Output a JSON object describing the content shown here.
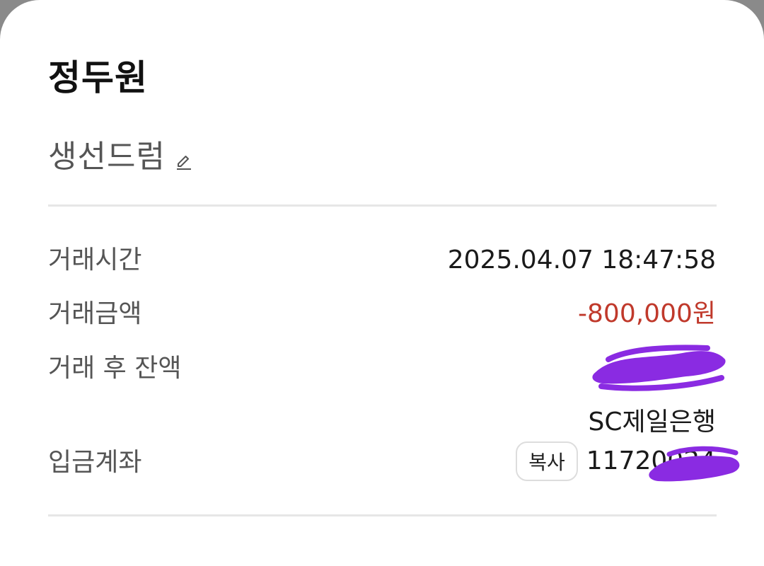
{
  "header": {
    "title": "정두원",
    "subtitle": "생선드럼",
    "edit_icon": "pencil-icon"
  },
  "details": {
    "time": {
      "label": "거래시간",
      "value": "2025.04.07 18:47:58"
    },
    "amount": {
      "label": "거래금액",
      "value": "-800,000원",
      "color": "#c0392b"
    },
    "balance": {
      "label": "거래 후 잔액",
      "value": ""
    },
    "account": {
      "label": "입금계좌",
      "bank": "SC제일은행",
      "copy_label": "복사",
      "number": "11720024"
    }
  },
  "colors": {
    "redaction": "#8a2be2"
  }
}
